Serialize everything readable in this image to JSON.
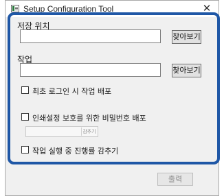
{
  "window": {
    "title": "Setup Configuration Tool",
    "close_glyph": "✕",
    "icon": "app-settings-icon"
  },
  "form": {
    "save_location_label": "저장 위치",
    "save_location_value": "",
    "browse_label_1": "찾아보기",
    "job_label": "작업",
    "job_value": "",
    "browse_label_2": "찾아보기",
    "option_first_login": "최초 로그인 시 작업 배포",
    "option_first_login_checked": false,
    "option_password": "인쇄설정 보호를 위한 비밀번호 배포",
    "option_password_checked": false,
    "password_value": "",
    "password_hide_label": "감추기",
    "option_hide_progress": "작업 실행 중 진행률 감추기",
    "option_hide_progress_checked": false
  },
  "footer": {
    "print_label": "출력"
  },
  "colors": {
    "highlight": "#1f57a6",
    "window_bg": "#f0f0f0",
    "button_bg": "#e1e1e1"
  }
}
